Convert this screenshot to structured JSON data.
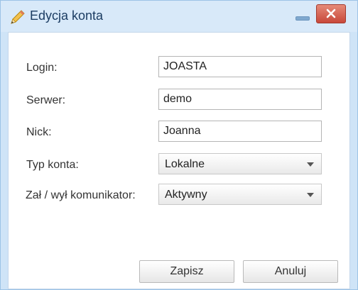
{
  "window": {
    "title": "Edycja konta",
    "icon": "pencil-icon",
    "controls": {
      "minimize_icon": "minimize-icon",
      "close_icon": "close-icon"
    }
  },
  "form": {
    "login": {
      "label": "Login:",
      "value": "JOASTA"
    },
    "server": {
      "label": "Serwer:",
      "value": "demo"
    },
    "nick": {
      "label": "Nick:",
      "value": "Joanna"
    },
    "account_type": {
      "label": "Typ konta:",
      "selected": "Lokalne"
    },
    "communicator": {
      "label": "Zał / wył komunikator:",
      "selected": "Aktywny"
    }
  },
  "buttons": {
    "save": "Zapisz",
    "cancel": "Anuluj"
  },
  "colors": {
    "titlebar": "#d8e9f9",
    "frame": "#cfe4f7",
    "title_text": "#1c3d63",
    "close_button": "#c8483a"
  }
}
